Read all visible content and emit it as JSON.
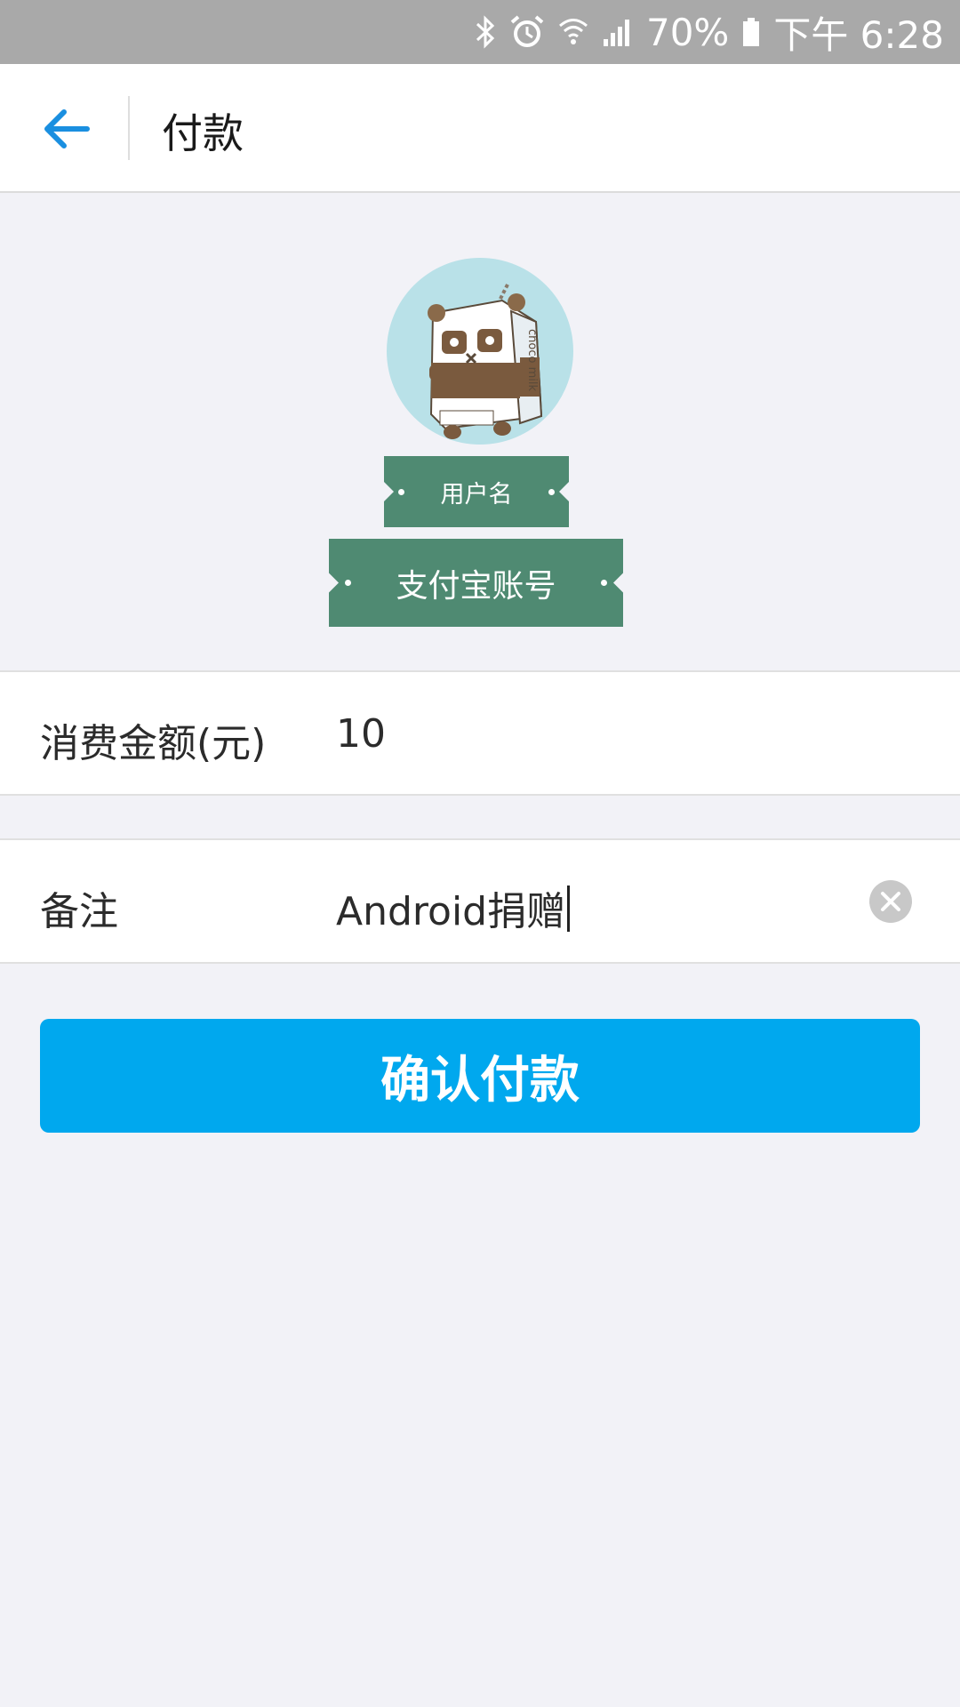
{
  "status_bar": {
    "battery": "70%",
    "time": "下午 6:28",
    "icons": [
      "bluetooth-icon",
      "alarm-icon",
      "wifi-icon",
      "signal-icon",
      "battery-icon"
    ]
  },
  "header": {
    "title": "付款",
    "back_icon": "arrow-left-icon"
  },
  "profile": {
    "username": "用户名",
    "account": "支付宝账号",
    "avatar_art_text": "choco milk"
  },
  "form": {
    "amount": {
      "label": "消费金额(元)",
      "value": "10"
    },
    "note": {
      "label": "备注",
      "value": "Android捐赠",
      "clear_icon": "clear-circle-icon"
    }
  },
  "actions": {
    "confirm_label": "确认付款"
  },
  "colors": {
    "status_bar": "#a9a9a9",
    "accent": "#00a8ee",
    "back_arrow": "#1a8fe0",
    "tag": "#4f8a72",
    "background": "#f2f2f7"
  }
}
